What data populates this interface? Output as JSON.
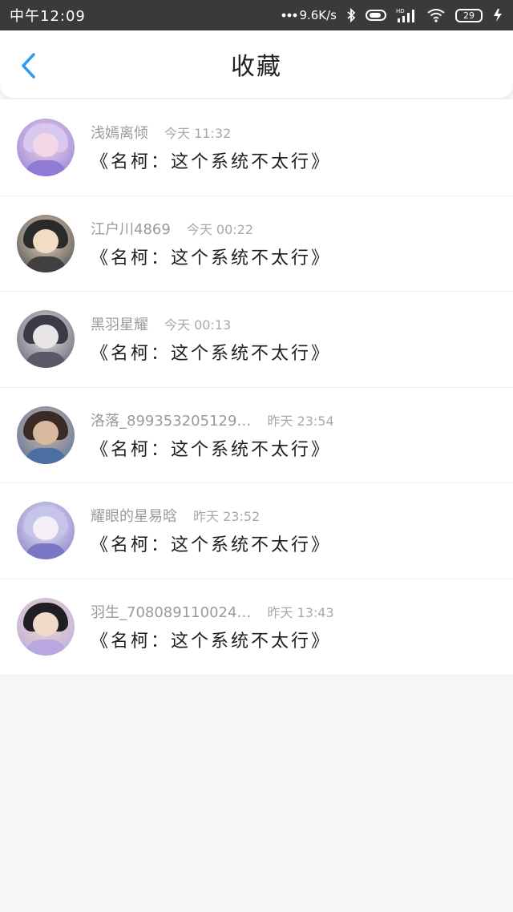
{
  "status_bar": {
    "time": "中午12:09",
    "network_speed": "9.6K/s",
    "battery": "29",
    "icons": [
      "dots-icon",
      "bluetooth-icon",
      "vibrate-icon",
      "hd-signal-icon",
      "wifi-icon",
      "battery-icon",
      "charging-icon"
    ]
  },
  "header": {
    "title": "收藏",
    "back_icon": "chevron-left-icon",
    "accent_color": "#2e9cf0"
  },
  "items": [
    {
      "name": "浅嫣离倾",
      "time": "今天 11:32",
      "title": "《名柯：这个系统不太行》",
      "avatar_colors": [
        "#d8c8f0",
        "#f3d7e6",
        "#8f7bd6"
      ]
    },
    {
      "name": "江户川4869",
      "time": "今天 00:22",
      "title": "《名柯：这个系统不太行》",
      "avatar_colors": [
        "#2a2a2a",
        "#f1dcc4",
        "#404040"
      ]
    },
    {
      "name": "黑羽星耀",
      "time": "今天 00:13",
      "title": "《名柯：这个系统不太行》",
      "avatar_colors": [
        "#3b3b46",
        "#e9e4e6",
        "#5a5a66"
      ]
    },
    {
      "name": "洛落_899353205129…",
      "time": "昨天 23:54",
      "title": "《名柯：这个系统不太行》",
      "avatar_colors": [
        "#3a2b26",
        "#d9b8a0",
        "#4a6fa0"
      ]
    },
    {
      "name": "耀眼的星易晗",
      "time": "昨天 23:52",
      "title": "《名柯：这个系统不太行》",
      "avatar_colors": [
        "#c6c4ea",
        "#f4eef6",
        "#7a76c4"
      ]
    },
    {
      "name": "羽生_708089110024…",
      "time": "昨天 13:43",
      "title": "《名柯：这个系统不太行》",
      "avatar_colors": [
        "#1e1e24",
        "#efd9c8",
        "#b9a7e0"
      ]
    }
  ]
}
